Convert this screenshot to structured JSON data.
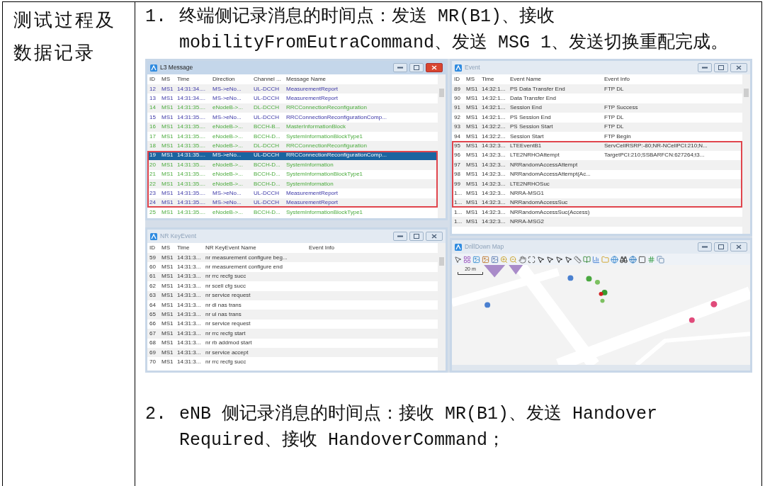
{
  "section_label": "测试过程及数据记录",
  "items": [
    {
      "kind": "step",
      "number": "1.",
      "text": "终端侧记录消息的时间点：发送 MR(B1)、接收 mobilityFromEutraCommand、发送 MSG 1、发送切换重配完成。"
    },
    {
      "kind": "screenshot",
      "windows": [
        {
          "kind": "table",
          "title": "L3 Message",
          "active": true,
          "columns": [
            "ID",
            "MS",
            "Time",
            "Direction",
            "Channel ...",
            "Message Name"
          ],
          "rows": [
            {
              "cells": [
                "12",
                "MS1",
                "14:31:34....",
                "MS->eNo...",
                "UL-DCCH",
                "MeasurementReport"
              ],
              "kind": "uplink",
              "selected": false,
              "boxed": false
            },
            {
              "cells": [
                "13",
                "MS1",
                "14:31:34....",
                "MS->eNo...",
                "UL-DCCH",
                "MeasurementReport"
              ],
              "kind": "uplink",
              "selected": false,
              "boxed": false
            },
            {
              "cells": [
                "14",
                "MS1",
                "14:31:35....",
                "eNodeB->...",
                "DL-DCCH",
                "RRCConnectionReconfiguration"
              ],
              "kind": "downlink",
              "selected": false,
              "boxed": false
            },
            {
              "cells": [
                "15",
                "MS1",
                "14:31:35....",
                "MS->eNo...",
                "UL-DCCH",
                "RRCConnectionReconfigurationComp..."
              ],
              "kind": "uplink",
              "selected": false,
              "boxed": false
            },
            {
              "cells": [
                "16",
                "MS1",
                "14:31:35....",
                "eNodeB->...",
                "BCCH-B...",
                "MasterInformationBlock"
              ],
              "kind": "downlink",
              "selected": false,
              "boxed": false
            },
            {
              "cells": [
                "17",
                "MS1",
                "14:31:35....",
                "eNodeB->...",
                "BCCH-D...",
                "SystemInformationBlockType1"
              ],
              "kind": "downlink",
              "selected": false,
              "boxed": false
            },
            {
              "cells": [
                "18",
                "MS1",
                "14:31:35....",
                "eNodeB->...",
                "DL-DCCH",
                "RRCConnectionReconfiguration"
              ],
              "kind": "downlink",
              "selected": false,
              "boxed": false
            },
            {
              "cells": [
                "19",
                "MS1",
                "14:31:35....",
                "MS->eNo...",
                "UL-DCCH",
                "RRCConnectionReconfigurationComp..."
              ],
              "selected": true,
              "boxed": true
            },
            {
              "cells": [
                "20",
                "MS1",
                "14:31:35....",
                "eNodeB->...",
                "BCCH-D...",
                "SystemInformation"
              ],
              "kind": "downlink",
              "selected": false,
              "boxed": true
            },
            {
              "cells": [
                "21",
                "MS1",
                "14:31:35....",
                "eNodeB->...",
                "BCCH-D...",
                "SystemInformationBlockType1"
              ],
              "kind": "downlink",
              "selected": false,
              "boxed": true
            },
            {
              "cells": [
                "22",
                "MS1",
                "14:31:35....",
                "eNodeB->...",
                "BCCH-D...",
                "SystemInformation"
              ],
              "kind": "downlink",
              "selected": false,
              "boxed": true
            },
            {
              "cells": [
                "23",
                "MS1",
                "14:31:35....",
                "MS->eNo...",
                "UL-DCCH",
                "MeasurementReport"
              ],
              "kind": "uplink",
              "selected": false,
              "boxed": true
            },
            {
              "cells": [
                "24",
                "MS1",
                "14:31:35....",
                "MS->eNo...",
                "UL-DCCH",
                "MeasurementReport"
              ],
              "kind": "uplink",
              "selected": false,
              "boxed": true
            },
            {
              "cells": [
                "25",
                "MS1",
                "14:31:35....",
                "eNodeB->...",
                "BCCH-D...",
                "SystemInformationBlockType1"
              ],
              "kind": "downlink",
              "selected": false,
              "boxed": false
            }
          ]
        },
        {
          "kind": "table",
          "title": "Event",
          "active": false,
          "columns": [
            "ID",
            "MS",
            "Time",
            "Event Name",
            "Event Info"
          ],
          "rows": [
            {
              "cells": [
                "89",
                "MS1",
                "14:32:1...",
                "PS Data Transfer End",
                "FTP DL"
              ],
              "selected": false,
              "boxed": false
            },
            {
              "cells": [
                "90",
                "MS1",
                "14:32:1...",
                "Data Transfer End"
              ],
              "selected": false,
              "boxed": false
            },
            {
              "cells": [
                "91",
                "MS1",
                "14:32:1...",
                "Session End",
                "FTP Success"
              ],
              "selected": false,
              "boxed": false
            },
            {
              "cells": [
                "92",
                "MS1",
                "14:32:1...",
                "PS Session End",
                "FTP DL"
              ],
              "selected": false,
              "boxed": false
            },
            {
              "cells": [
                "93",
                "MS1",
                "14:32:2...",
                "PS Session Start",
                "FTP DL"
              ],
              "selected": false,
              "boxed": false
            },
            {
              "cells": [
                "94",
                "MS1",
                "14:32:2...",
                "Session Start",
                "FTP Begin"
              ],
              "selected": false,
              "boxed": false
            },
            {
              "cells": [
                "95",
                "MS1",
                "14:32:3...",
                "LTEEventB1",
                "ServCellRSRP:-80;NR-NCellPCI:210;N..."
              ],
              "selected": false,
              "boxed": true
            },
            {
              "cells": [
                "96",
                "MS1",
                "14:32:3...",
                "LTE2NRHOAttempt",
                "TargetPCI:210;SSBARFCN:627264;t3..."
              ],
              "selected": false,
              "boxed": true
            },
            {
              "cells": [
                "97",
                "MS1",
                "14:32:3...",
                "NRRandomAccessAttempt"
              ],
              "selected": false,
              "boxed": true
            },
            {
              "cells": [
                "98",
                "MS1",
                "14:32:3...",
                "NRRandomAccessAttempt(Ac..."
              ],
              "selected": false,
              "boxed": true
            },
            {
              "cells": [
                "99",
                "MS1",
                "14:32:3...",
                "LTE2NRHOSuc"
              ],
              "selected": false,
              "boxed": true
            },
            {
              "cells": [
                "1...",
                "MS1",
                "14:32:3...",
                "NRRA-MSG1"
              ],
              "selected": false,
              "boxed": true
            },
            {
              "cells": [
                "1...",
                "MS1",
                "14:32:3...",
                "NRRandomAccessSuc"
              ],
              "selected": false,
              "boxed": true
            },
            {
              "cells": [
                "1...",
                "MS1",
                "14:32:3...",
                "NRRandomAccessSuc(Access)"
              ],
              "selected": false,
              "boxed": false
            },
            {
              "cells": [
                "1...",
                "MS1",
                "14:32:3...",
                "NRRA-MSG2"
              ],
              "selected": false,
              "boxed": false
            }
          ]
        },
        {
          "kind": "table",
          "title": "NR KeyEvent",
          "active": false,
          "columns": [
            "ID",
            "MS",
            "Time",
            "NR KeyEvent Name",
            "Event Info"
          ],
          "rows": [
            {
              "cells": [
                "59",
                "MS1",
                "14:31:3...",
                "nr measurement configure beg..."
              ],
              "selected": false,
              "boxed": false
            },
            {
              "cells": [
                "60",
                "MS1",
                "14:31:3...",
                "nr measurement configure end"
              ],
              "selected": false,
              "boxed": false
            },
            {
              "cells": [
                "61",
                "MS1",
                "14:31:3...",
                "nr rrc recfg succ"
              ],
              "selected": false,
              "boxed": false
            },
            {
              "cells": [
                "62",
                "MS1",
                "14:31:3...",
                "nr scell cfg succ"
              ],
              "selected": false,
              "boxed": false
            },
            {
              "cells": [
                "63",
                "MS1",
                "14:31:3...",
                "nr service request"
              ],
              "selected": false,
              "boxed": false
            },
            {
              "cells": [
                "64",
                "MS1",
                "14:31:3...",
                "nr dl nas trans"
              ],
              "selected": false,
              "boxed": false
            },
            {
              "cells": [
                "65",
                "MS1",
                "14:31:3...",
                "nr ul nas trans"
              ],
              "selected": false,
              "boxed": false
            },
            {
              "cells": [
                "66",
                "MS1",
                "14:31:3...",
                "nr service request"
              ],
              "selected": false,
              "boxed": false
            },
            {
              "cells": [
                "67",
                "MS1",
                "14:31:3...",
                "nr rrc recfg start"
              ],
              "selected": false,
              "boxed": false
            },
            {
              "cells": [
                "68",
                "MS1",
                "14:31:3...",
                "nr rb addmod start"
              ],
              "selected": false,
              "boxed": false
            },
            {
              "cells": [
                "69",
                "MS1",
                "14:31:3...",
                "nr service accept"
              ],
              "selected": false,
              "boxed": false
            },
            {
              "cells": [
                "70",
                "MS1",
                "14:31:3...",
                "nr rrc recfg succ"
              ],
              "selected": false,
              "boxed": false
            }
          ]
        },
        {
          "kind": "map",
          "title": "DrillDown Map",
          "active": false,
          "scale": "20 m"
        }
      ]
    },
    {
      "kind": "step",
      "number": "2.",
      "text": "eNB 侧记录消息的时间点：接收 MR(B1)、发送 Handover Required、接收 HandoverCommand；"
    }
  ]
}
